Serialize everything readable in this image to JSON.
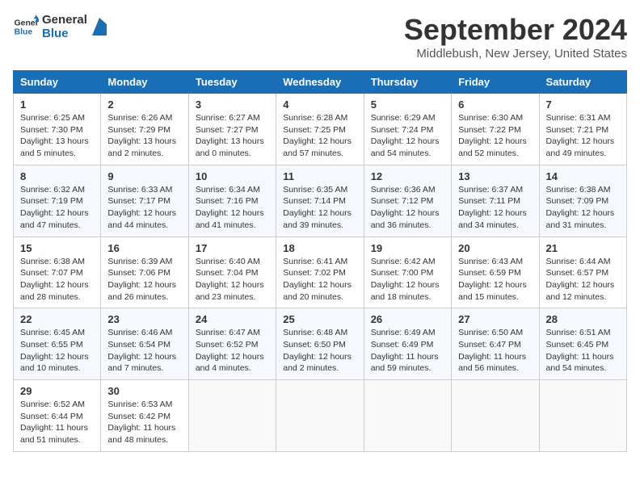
{
  "logo": {
    "line1": "General",
    "line2": "Blue"
  },
  "title": "September 2024",
  "subtitle": "Middlebush, New Jersey, United States",
  "days": [
    "Sunday",
    "Monday",
    "Tuesday",
    "Wednesday",
    "Thursday",
    "Friday",
    "Saturday"
  ],
  "weeks": [
    [
      {
        "day": "1",
        "sunrise": "6:25 AM",
        "sunset": "7:30 PM",
        "daylight": "13 hours and 5 minutes."
      },
      {
        "day": "2",
        "sunrise": "6:26 AM",
        "sunset": "7:29 PM",
        "daylight": "13 hours and 2 minutes."
      },
      {
        "day": "3",
        "sunrise": "6:27 AM",
        "sunset": "7:27 PM",
        "daylight": "13 hours and 0 minutes."
      },
      {
        "day": "4",
        "sunrise": "6:28 AM",
        "sunset": "7:25 PM",
        "daylight": "12 hours and 57 minutes."
      },
      {
        "day": "5",
        "sunrise": "6:29 AM",
        "sunset": "7:24 PM",
        "daylight": "12 hours and 54 minutes."
      },
      {
        "day": "6",
        "sunrise": "6:30 AM",
        "sunset": "7:22 PM",
        "daylight": "12 hours and 52 minutes."
      },
      {
        "day": "7",
        "sunrise": "6:31 AM",
        "sunset": "7:21 PM",
        "daylight": "12 hours and 49 minutes."
      }
    ],
    [
      {
        "day": "8",
        "sunrise": "6:32 AM",
        "sunset": "7:19 PM",
        "daylight": "12 hours and 47 minutes."
      },
      {
        "day": "9",
        "sunrise": "6:33 AM",
        "sunset": "7:17 PM",
        "daylight": "12 hours and 44 minutes."
      },
      {
        "day": "10",
        "sunrise": "6:34 AM",
        "sunset": "7:16 PM",
        "daylight": "12 hours and 41 minutes."
      },
      {
        "day": "11",
        "sunrise": "6:35 AM",
        "sunset": "7:14 PM",
        "daylight": "12 hours and 39 minutes."
      },
      {
        "day": "12",
        "sunrise": "6:36 AM",
        "sunset": "7:12 PM",
        "daylight": "12 hours and 36 minutes."
      },
      {
        "day": "13",
        "sunrise": "6:37 AM",
        "sunset": "7:11 PM",
        "daylight": "12 hours and 34 minutes."
      },
      {
        "day": "14",
        "sunrise": "6:38 AM",
        "sunset": "7:09 PM",
        "daylight": "12 hours and 31 minutes."
      }
    ],
    [
      {
        "day": "15",
        "sunrise": "6:38 AM",
        "sunset": "7:07 PM",
        "daylight": "12 hours and 28 minutes."
      },
      {
        "day": "16",
        "sunrise": "6:39 AM",
        "sunset": "7:06 PM",
        "daylight": "12 hours and 26 minutes."
      },
      {
        "day": "17",
        "sunrise": "6:40 AM",
        "sunset": "7:04 PM",
        "daylight": "12 hours and 23 minutes."
      },
      {
        "day": "18",
        "sunrise": "6:41 AM",
        "sunset": "7:02 PM",
        "daylight": "12 hours and 20 minutes."
      },
      {
        "day": "19",
        "sunrise": "6:42 AM",
        "sunset": "7:00 PM",
        "daylight": "12 hours and 18 minutes."
      },
      {
        "day": "20",
        "sunrise": "6:43 AM",
        "sunset": "6:59 PM",
        "daylight": "12 hours and 15 minutes."
      },
      {
        "day": "21",
        "sunrise": "6:44 AM",
        "sunset": "6:57 PM",
        "daylight": "12 hours and 12 minutes."
      }
    ],
    [
      {
        "day": "22",
        "sunrise": "6:45 AM",
        "sunset": "6:55 PM",
        "daylight": "12 hours and 10 minutes."
      },
      {
        "day": "23",
        "sunrise": "6:46 AM",
        "sunset": "6:54 PM",
        "daylight": "12 hours and 7 minutes."
      },
      {
        "day": "24",
        "sunrise": "6:47 AM",
        "sunset": "6:52 PM",
        "daylight": "12 hours and 4 minutes."
      },
      {
        "day": "25",
        "sunrise": "6:48 AM",
        "sunset": "6:50 PM",
        "daylight": "12 hours and 2 minutes."
      },
      {
        "day": "26",
        "sunrise": "6:49 AM",
        "sunset": "6:49 PM",
        "daylight": "11 hours and 59 minutes."
      },
      {
        "day": "27",
        "sunrise": "6:50 AM",
        "sunset": "6:47 PM",
        "daylight": "11 hours and 56 minutes."
      },
      {
        "day": "28",
        "sunrise": "6:51 AM",
        "sunset": "6:45 PM",
        "daylight": "11 hours and 54 minutes."
      }
    ],
    [
      {
        "day": "29",
        "sunrise": "6:52 AM",
        "sunset": "6:44 PM",
        "daylight": "11 hours and 51 minutes."
      },
      {
        "day": "30",
        "sunrise": "6:53 AM",
        "sunset": "6:42 PM",
        "daylight": "11 hours and 48 minutes."
      },
      null,
      null,
      null,
      null,
      null
    ]
  ],
  "labels": {
    "sunrise": "Sunrise:",
    "sunset": "Sunset:",
    "daylight": "Daylight:"
  }
}
